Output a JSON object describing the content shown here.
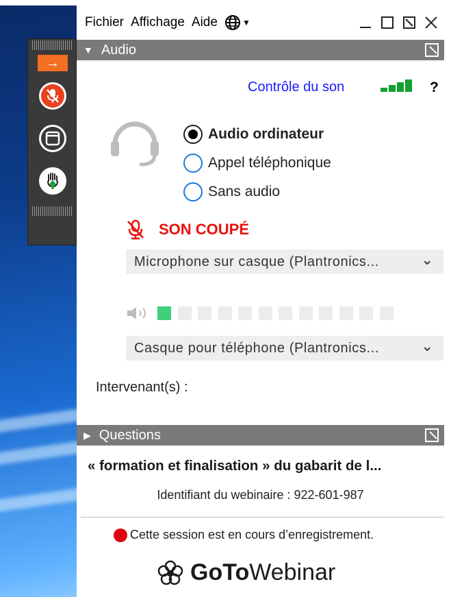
{
  "menubar": {
    "items": [
      "Fichier",
      "Affichage",
      "Aide"
    ],
    "language_icon": "globe-icon"
  },
  "window_controls": [
    "minimize-icon",
    "restore-icon",
    "popout-icon",
    "close-icon"
  ],
  "grabtab": {
    "items": [
      "arrow-right-icon",
      "microphone-muted-icon",
      "screen-icon",
      "raise-hand-icon"
    ],
    "colors": {
      "arrow": "#f36f21",
      "mic_muted": "#e8411e",
      "background": "#3a3a3a"
    }
  },
  "audio_panel": {
    "title": "Audio",
    "sound_check": "Contrôle du son",
    "signal_level": 3,
    "help": "?",
    "options": [
      {
        "label": "Audio ordinateur",
        "selected": true
      },
      {
        "label": "Appel téléphonique",
        "selected": false
      },
      {
        "label": "Sans audio",
        "selected": false
      }
    ],
    "muted_label": "SON COUPÉ",
    "microphone": "Microphone sur casque (Plantronics...",
    "speaker_level": 1,
    "speaker_segments": 12,
    "speakers": "Casque pour téléphone (Plantronics...",
    "talking_label": "Intervenant(s) :"
  },
  "questions_panel": {
    "title": "Questions"
  },
  "webinar": {
    "title": "« formation et finalisation » du gabarit de l...",
    "id_label": "Identifiant du webinaire : 922-601-987",
    "recording": "Cette session est en cours d’enregistrement."
  },
  "brand": {
    "bold": "GoTo",
    "light": "Webinar"
  },
  "colors": {
    "link": "#1a1aff",
    "muted": "#e8120c",
    "level_on": "#3fd07c",
    "signal": "#12a02e",
    "recording": "#e1000f",
    "header": "#7a7a7a"
  }
}
